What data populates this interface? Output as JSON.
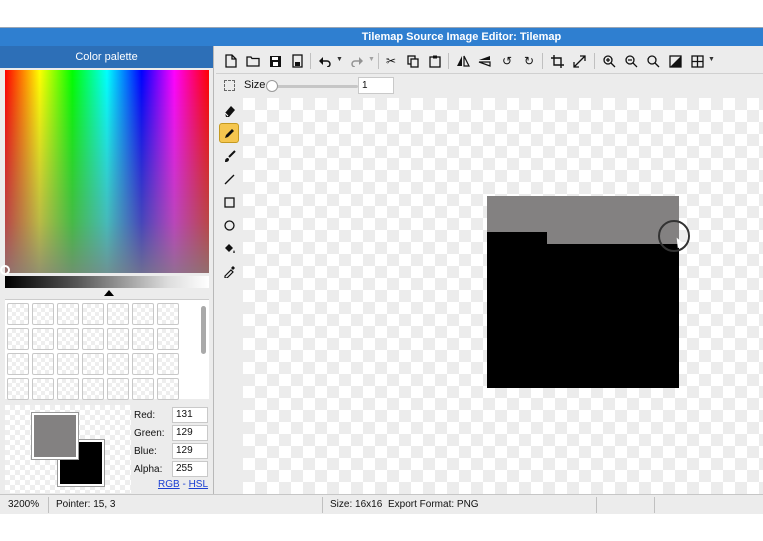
{
  "window": {
    "title": "Tilemap Source Image Editor: Tilemap"
  },
  "palette": {
    "header": "Color palette",
    "fields": [
      {
        "label": "Red:",
        "value": "131"
      },
      {
        "label": "Green:",
        "value": "129"
      },
      {
        "label": "Blue:",
        "value": "129"
      },
      {
        "label": "Alpha:",
        "value": "255"
      }
    ],
    "mode_rgb": "RGB",
    "mode_sep": "-",
    "mode_hsl": "HSL",
    "foreground_color": "#838181",
    "background_color": "#000000"
  },
  "toolbar": {
    "icons": [
      "new-file-icon",
      "open-folder-icon",
      "save-icon",
      "save-as-icon",
      "undo-icon",
      "redo-icon",
      "cut-icon",
      "copy-icon",
      "paste-icon",
      "flip-horizontal-icon",
      "flip-vertical-icon",
      "rotate-left-icon",
      "rotate-right-icon",
      "crop-icon",
      "resize-icon",
      "zoom-in-icon",
      "zoom-out-icon",
      "zoom-fit-icon",
      "invert-icon",
      "grid-icon"
    ]
  },
  "sizebar": {
    "label": "Size",
    "value": "1"
  },
  "tools": [
    "eraser-icon",
    "pencil-icon",
    "brush-icon",
    "line-icon",
    "rectangle-icon",
    "ellipse-icon",
    "fill-bucket-icon",
    "eyedropper-icon"
  ],
  "status": {
    "zoom": "3200%",
    "pointer": "Pointer: 15, 3",
    "size": "Size: 16x16",
    "export": "Export Format: PNG"
  },
  "colors": {
    "title_bar": "#2f7fd0",
    "palette_header": "#2d6fb7",
    "active_tool": "#f5c64f"
  }
}
